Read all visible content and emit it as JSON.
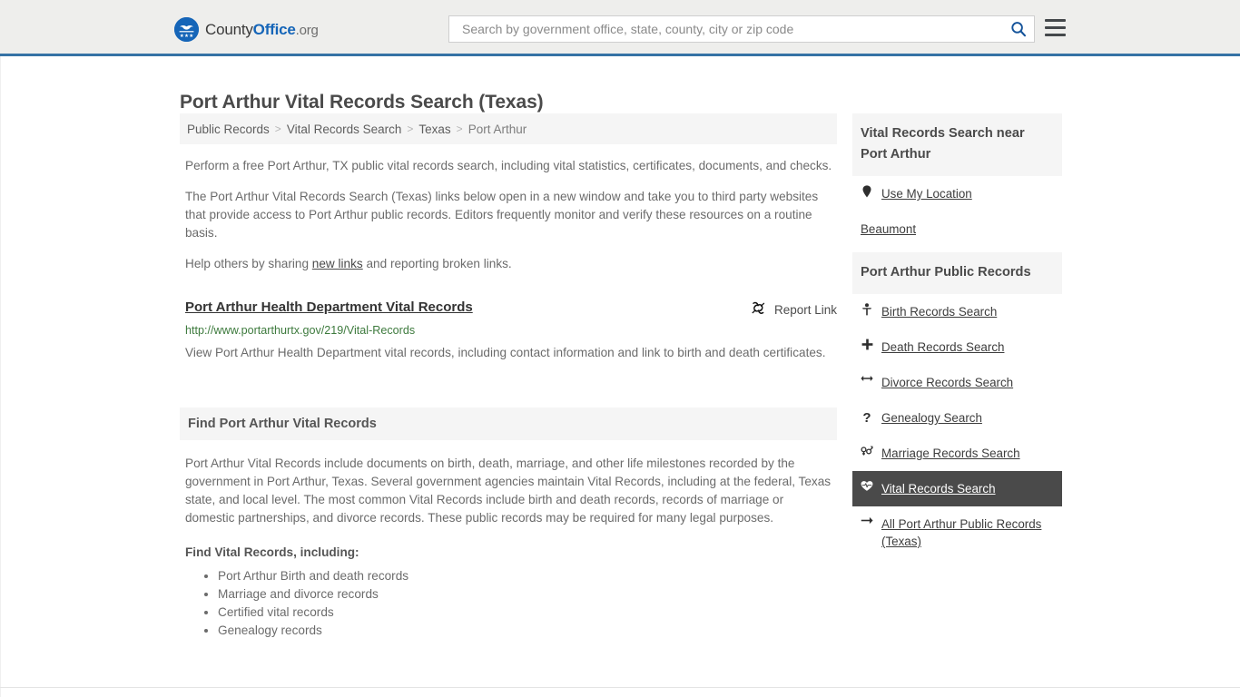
{
  "header": {
    "logo": {
      "part1": "County",
      "part2": "Office",
      "part3": ".org",
      "icon": "eagle-seal-icon"
    },
    "search": {
      "placeholder": "Search by government office, state, county, city or zip code",
      "value": ""
    },
    "menu_label": "Menu"
  },
  "page": {
    "title": "Port Arthur Vital Records Search (Texas)"
  },
  "breadcrumb": {
    "items": [
      {
        "label": "Public Records",
        "current": false
      },
      {
        "label": "Vital Records Search",
        "current": false
      },
      {
        "label": "Texas",
        "current": false
      },
      {
        "label": "Port Arthur",
        "current": true
      }
    ],
    "separator": ">"
  },
  "intro": {
    "para1": "Perform a free Port Arthur, TX public vital records search, including vital statistics, certificates, documents, and checks.",
    "para2": "The Port Arthur Vital Records Search (Texas) links below open in a new window and take you to third party websites that provide access to Port Arthur public records. Editors frequently monitor and verify these resources on a routine basis.",
    "para3_before": "Help others by sharing ",
    "para3_link": "new links",
    "para3_after": " and reporting broken links."
  },
  "result": {
    "title": "Port Arthur Health Department Vital Records",
    "url": "http://www.portarthurtx.gov/219/Vital-Records",
    "description": "View Port Arthur Health Department vital records, including contact information and link to birth and death certificates.",
    "report_label": "Report Link",
    "report_icon": "broken-link-icon"
  },
  "find_section": {
    "heading": "Find Port Arthur Vital Records",
    "body": "Port Arthur Vital Records include documents on birth, death, marriage, and other life milestones recorded by the government in Port Arthur, Texas. Several government agencies maintain Vital Records, including at the federal, Texas state, and local level. The most common Vital Records include birth and death records, records of marriage or domestic partnerships, and divorce records. These public records may be required for many legal purposes.",
    "sub_heading": "Find Vital Records, including:",
    "bullets": [
      "Port Arthur Birth and death records",
      "Marriage and divorce records",
      "Certified vital records",
      "Genealogy records"
    ]
  },
  "sidebar": {
    "near_card": {
      "heading": "Vital Records Search near Port Arthur",
      "items": [
        {
          "label": "Use My Location",
          "icon": "map-pin-icon",
          "has_icon": true,
          "active": false
        },
        {
          "label": "Beaumont",
          "icon": "",
          "has_icon": false,
          "active": false
        }
      ]
    },
    "public_records_card": {
      "heading": "Port Arthur Public Records",
      "items": [
        {
          "label": "Birth Records Search",
          "icon": "baby-icon",
          "glyph": "Ѧ",
          "has_icon": true,
          "active": false
        },
        {
          "label": "Death Records Search",
          "icon": "cross-icon",
          "glyph": "✚",
          "has_icon": true,
          "active": false
        },
        {
          "label": "Divorce Records Search",
          "icon": "arrows-split-icon",
          "glyph": "↔",
          "has_icon": true,
          "active": false
        },
        {
          "label": "Genealogy Search",
          "icon": "question-mark-icon",
          "glyph": "?",
          "has_icon": true,
          "active": false
        },
        {
          "label": "Marriage Records Search",
          "icon": "venus-mars-icon",
          "glyph": "⚥",
          "has_icon": true,
          "active": false
        },
        {
          "label": "Vital Records Search",
          "icon": "heartbeat-icon",
          "glyph": "❥",
          "has_icon": true,
          "active": true
        },
        {
          "label": "All Port Arthur Public Records (Texas)",
          "icon": "arrow-right-icon",
          "glyph": "→",
          "has_icon": true,
          "active": false
        }
      ]
    }
  },
  "colors": {
    "brand_blue": "#1565b8",
    "header_rule": "#3572a5",
    "header_bg": "#eeeeec",
    "panel_bg": "#f5f5f5",
    "active_bg": "#4a4a4a",
    "url_green": "#3d7a3d",
    "body_text": "#6b6b6b"
  }
}
